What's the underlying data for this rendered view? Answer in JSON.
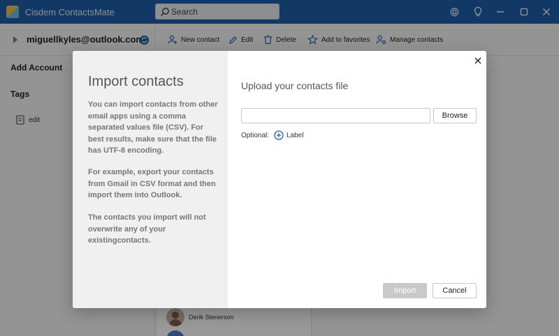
{
  "app": {
    "title": "Cisdem ContactsMate"
  },
  "search": {
    "placeholder": "Search"
  },
  "titlebar": {
    "icons": [
      "settings-icon",
      "lightbulb-icon",
      "minimize-icon",
      "maximize-icon",
      "close-icon"
    ]
  },
  "sidebar": {
    "account": "miguellkyles@outlook.com",
    "add_account": "Add Account",
    "tags_heading": "Tags",
    "tags": [
      {
        "label": "edit"
      }
    ]
  },
  "toolbar": {
    "new_contact": "New contact",
    "edit": "Edit",
    "delete": "Delete",
    "add_favorites": "Add to favorites",
    "manage_contacts": "Manage contacts"
  },
  "contacts": [
    {
      "name": "Derik Stenerson"
    }
  ],
  "dialog": {
    "title": "Import contacts",
    "paragraphs": [
      "You can import contacts from other email apps using a comma separated values file (CSV). For best results, make sure that the file has UTF-8 encoding.",
      "For example, export your contacts from Gmail in CSV format and then import them into Outlook.",
      "The contacts you import will not overwrite any of your existingcontacts."
    ],
    "upload_title": "Upload your contacts file",
    "file_value": "",
    "browse": "Browse",
    "optional": "Optional:",
    "label_link": "Label",
    "import": "Import",
    "cancel": "Cancel",
    "import_enabled": false
  },
  "colors": {
    "titlebar": "#1e60a8",
    "accent": "#1e60a8",
    "disabled_button": "#c9c9c9"
  }
}
